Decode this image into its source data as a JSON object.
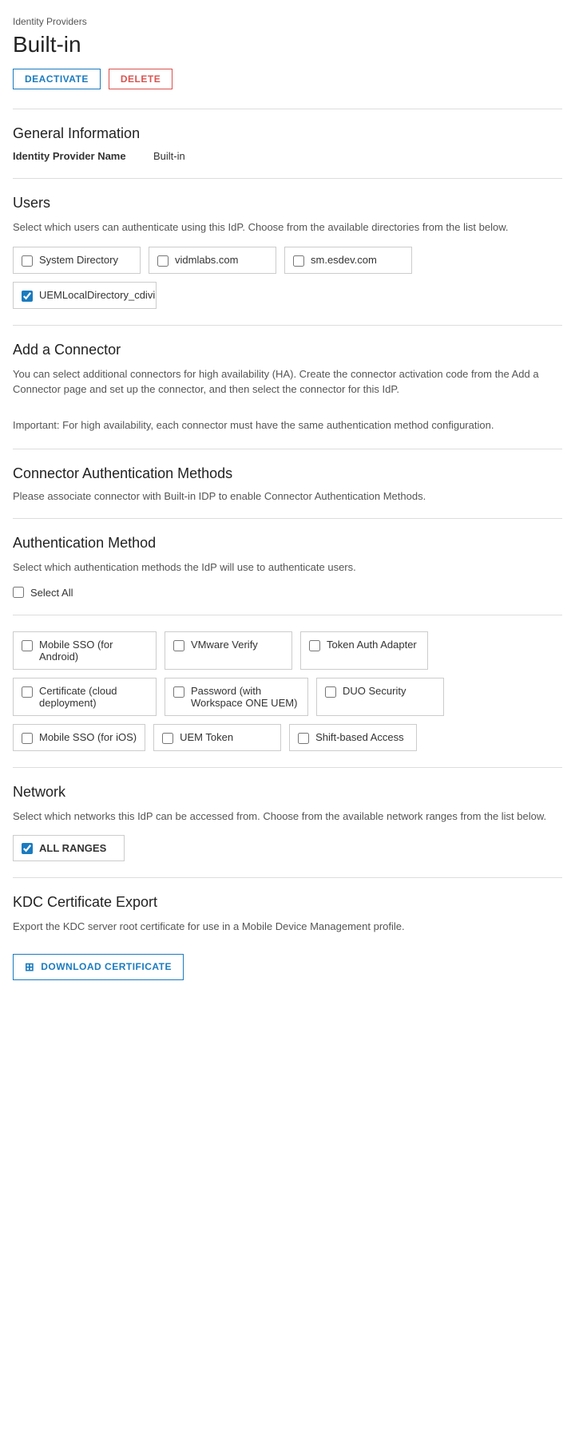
{
  "breadcrumb": "Identity Providers",
  "page_title": "Built-in",
  "buttons": {
    "deactivate": "DEACTIVATE",
    "delete": "DELETE"
  },
  "general_information": {
    "title": "General Information",
    "field_label": "Identity Provider Name",
    "field_value": "Built-in"
  },
  "users": {
    "title": "Users",
    "description": "Select which users can authenticate using this IdP. Choose from the available directories from the list below.",
    "directories": [
      {
        "id": "dir1",
        "label": "System Directory",
        "checked": false
      },
      {
        "id": "dir2",
        "label": "vidmlabs.com",
        "checked": false
      },
      {
        "id": "dir3",
        "label": "sm.esdev.com",
        "checked": false
      },
      {
        "id": "dir4",
        "label": "UEMLocalDirectory_cdivi",
        "checked": true
      }
    ]
  },
  "add_connector": {
    "title": "Add a Connector",
    "description1": "You can select additional connectors for high availability (HA). Create the connector activation code from the Add a Connector page and set up the connector, and then select the connector for this IdP.",
    "description2": "Important: For high availability, each connector must have the same authentication method configuration."
  },
  "connector_auth_methods": {
    "title": "Connector Authentication Methods",
    "note": "Please associate connector with Built-in IDP to enable Connector Authentication Methods."
  },
  "authentication_method": {
    "title": "Authentication Method",
    "description": "Select which authentication methods the IdP will use to authenticate users.",
    "select_all_label": "Select All",
    "methods": [
      {
        "id": "m1",
        "label": "Mobile SSO (for Android)",
        "checked": false
      },
      {
        "id": "m2",
        "label": "VMware Verify",
        "checked": false
      },
      {
        "id": "m3",
        "label": "Token Auth Adapter",
        "checked": false
      },
      {
        "id": "m4",
        "label": "Certificate (cloud deployment)",
        "checked": false
      },
      {
        "id": "m5",
        "label": "Password (with Workspace ONE UEM)",
        "checked": false
      },
      {
        "id": "m6",
        "label": "DUO Security",
        "checked": false
      },
      {
        "id": "m7",
        "label": "Mobile SSO (for iOS)",
        "checked": false
      },
      {
        "id": "m8",
        "label": "UEM Token",
        "checked": false
      },
      {
        "id": "m9",
        "label": "Shift-based Access",
        "checked": false
      }
    ]
  },
  "network": {
    "title": "Network",
    "description": "Select which networks this IdP can be accessed from. Choose from the available network ranges from the list below.",
    "ranges": [
      {
        "id": "r1",
        "label": "ALL RANGES",
        "checked": true
      }
    ]
  },
  "kdc_certificate": {
    "title": "KDC Certificate Export",
    "description": "Export the KDC server root certificate for use in a Mobile Device Management profile.",
    "download_label": "DOWNLOAD CERTIFICATE"
  }
}
